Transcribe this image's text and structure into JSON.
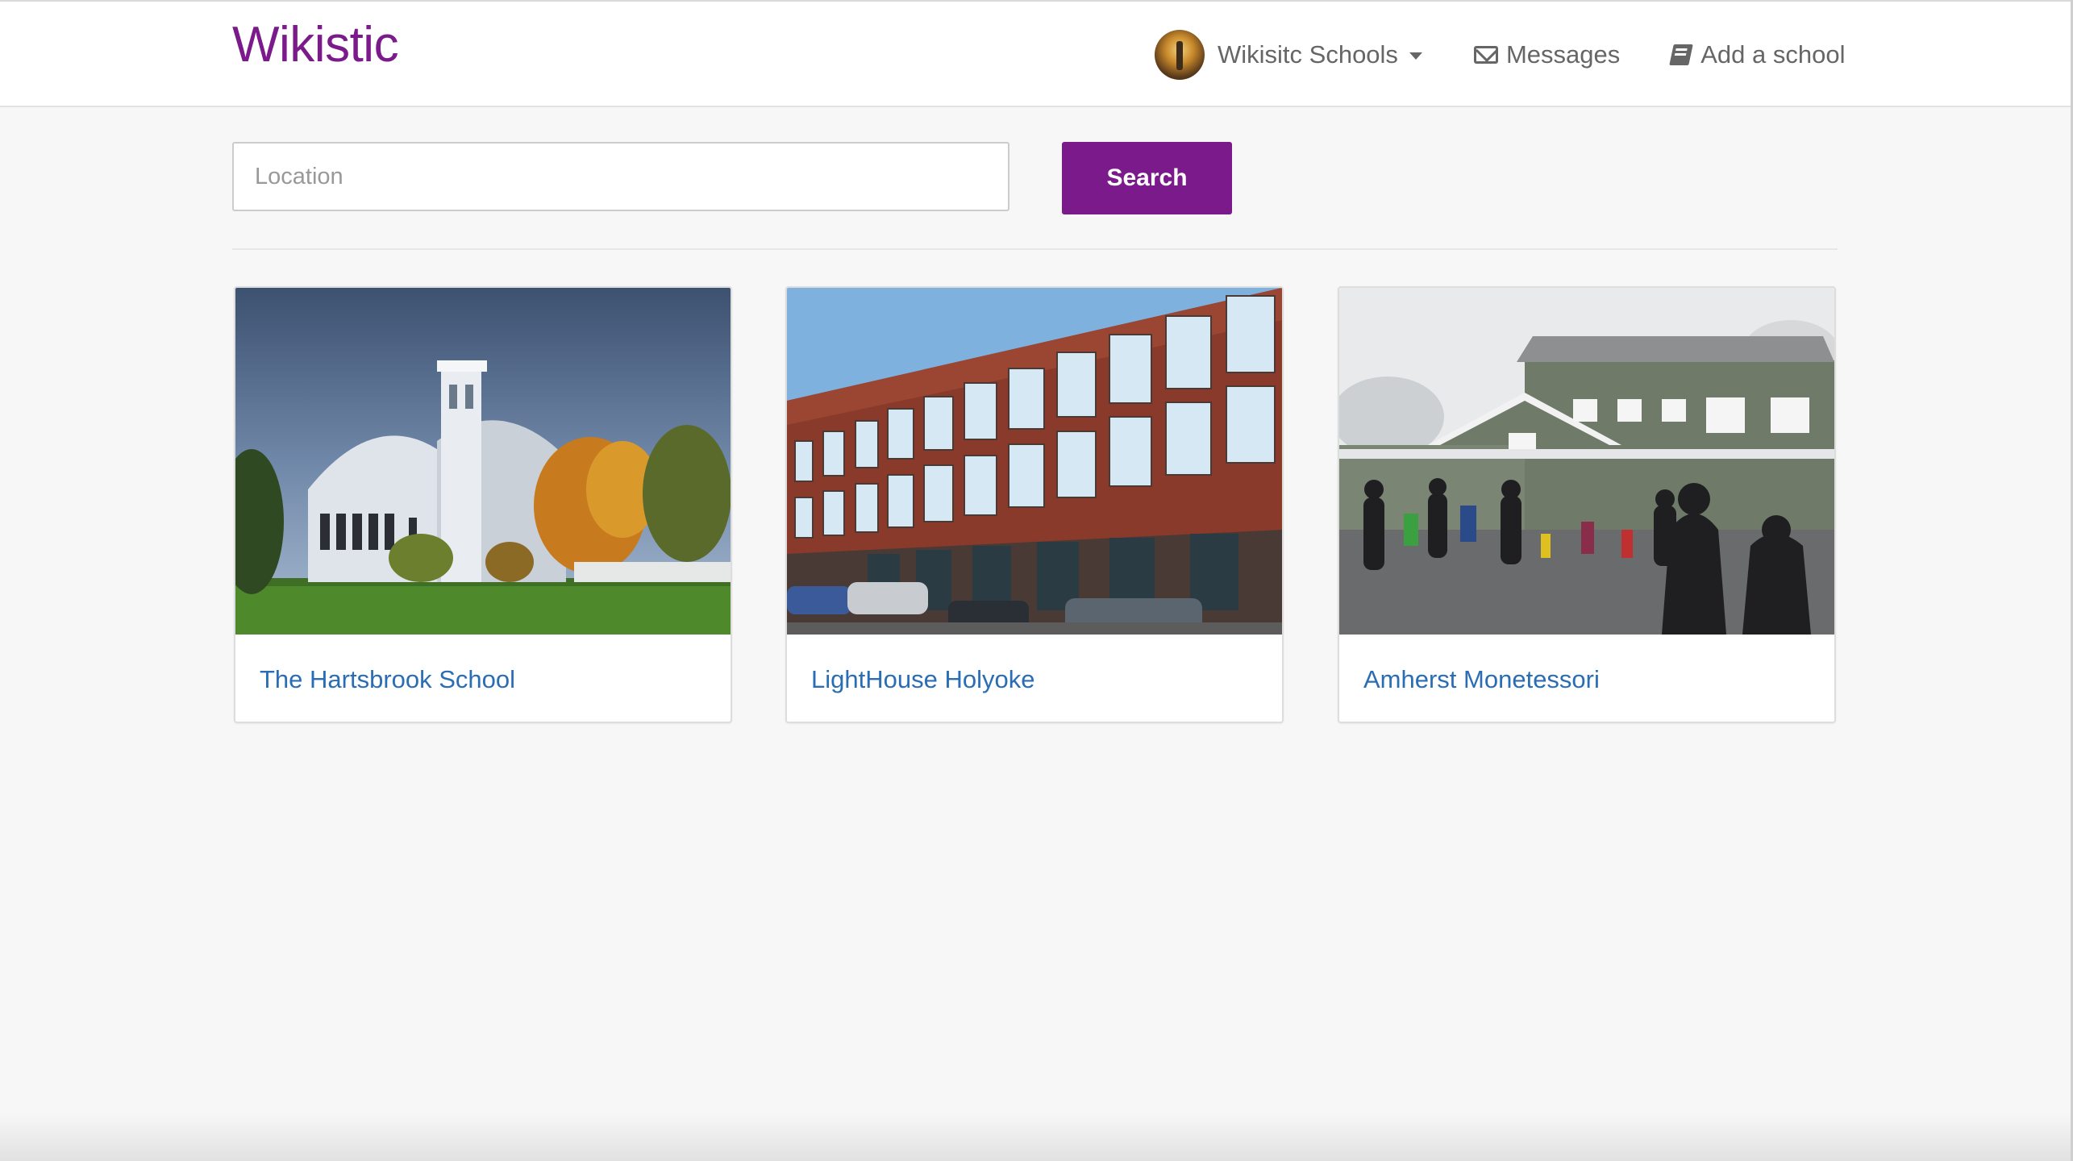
{
  "navbar": {
    "brand": "Wikistic",
    "account_label": "Wikisitc Schools",
    "messages_label": "Messages",
    "add_school_label": "Add a school"
  },
  "search": {
    "placeholder": "Location",
    "value": "",
    "button_label": "Search"
  },
  "schools": [
    {
      "name": "The Hartsbrook School"
    },
    {
      "name": "LightHouse Holyoke"
    },
    {
      "name": "Amherst Monetessori"
    }
  ],
  "colors": {
    "brand": "#7b1a8a",
    "link": "#2a6db5",
    "background": "#f7f7f7"
  }
}
